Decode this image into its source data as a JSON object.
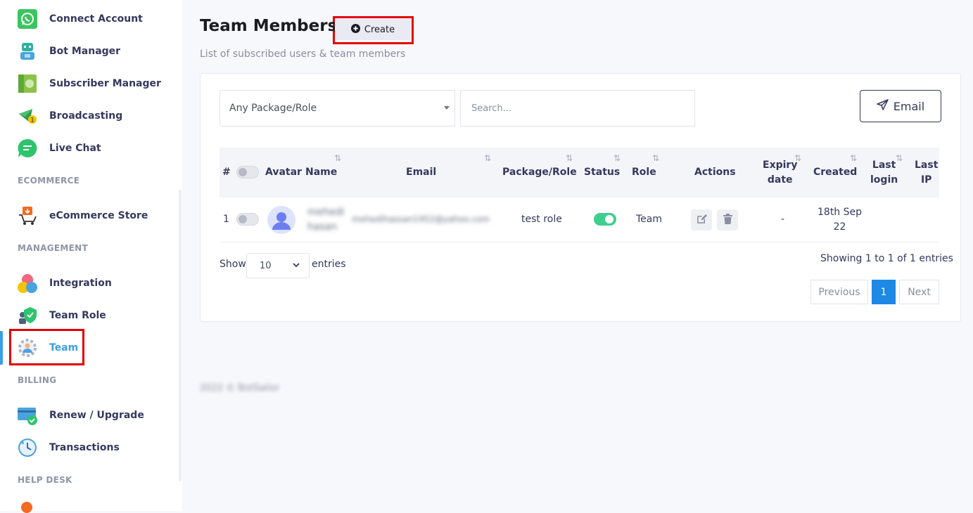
{
  "sidebar": {
    "items": [
      {
        "label": "Connect Account",
        "icon": "whatsapp-icon"
      },
      {
        "label": "Bot Manager",
        "icon": "bot-icon"
      },
      {
        "label": "Subscriber Manager",
        "icon": "subscriber-icon"
      },
      {
        "label": "Broadcasting",
        "icon": "broadcast-icon"
      },
      {
        "label": "Live Chat",
        "icon": "chat-icon"
      },
      {
        "label": "eCommerce Store",
        "icon": "cart-icon"
      },
      {
        "label": "Integration",
        "icon": "integration-icon"
      },
      {
        "label": "Team Role",
        "icon": "team-role-icon"
      },
      {
        "label": "Team",
        "icon": "team-icon",
        "active": true
      },
      {
        "label": "Renew / Upgrade",
        "icon": "card-icon"
      },
      {
        "label": "Transactions",
        "icon": "transactions-icon"
      }
    ],
    "sections": {
      "ecommerce": "ECOMMERCE",
      "management": "MANAGEMENT",
      "billing": "BILLING",
      "helpdesk": "HELP DESK"
    },
    "accent_color": "#3a9ee8"
  },
  "header": {
    "title": "Team Members",
    "create_label": "Create",
    "subtitle": "List of subscribed users & team members"
  },
  "filters": {
    "package_select": "Any Package/Role",
    "search_placeholder": "Search...",
    "email_label": "Email"
  },
  "table": {
    "columns": {
      "index": "#",
      "avatar": "Avatar",
      "name": "Name",
      "email": "Email",
      "package": "Package/Role",
      "status": "Status",
      "role": "Role",
      "actions": "Actions",
      "expiry_line1": "Expiry",
      "expiry_line2": "date",
      "created": "Created",
      "last_login_line1": "Last",
      "last_login_line2": "login",
      "last_ip_line1": "Last",
      "last_ip_line2": "IP"
    },
    "rows": [
      {
        "index": "1",
        "name_line1": "mehedi",
        "name_line2": "hasan",
        "email": "mehedihassan1952@yahoo.com",
        "package": "test role",
        "status_on": true,
        "role": "Team",
        "expiry": "-",
        "created_line1": "18th Sep",
        "created_line2": "22"
      }
    ]
  },
  "pagination": {
    "show_label": "Show",
    "page_length": "10",
    "entries_label": "entries",
    "info": "Showing 1 to 1 of 1 entries",
    "previous": "Previous",
    "current": "1",
    "next": "Next"
  },
  "footer": "2022 © BotSailor"
}
